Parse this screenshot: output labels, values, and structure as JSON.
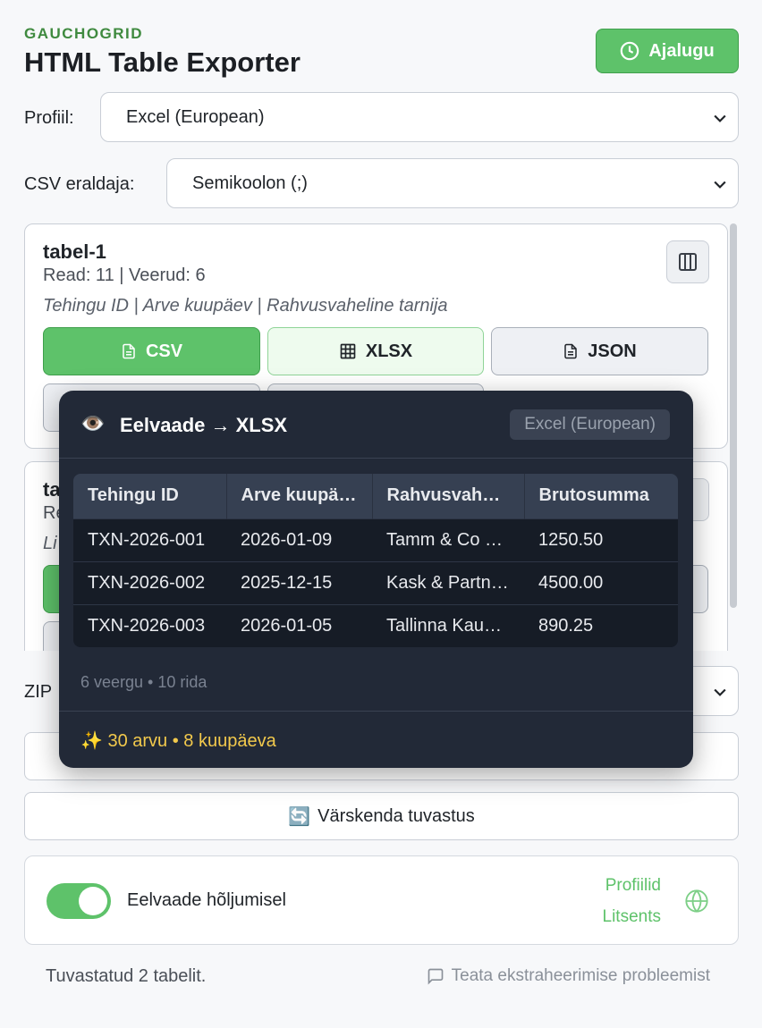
{
  "header": {
    "brand": "GAUCHOGRID",
    "title": "HTML Table Exporter",
    "history_label": "Ajalugu",
    "history_icon": "clock-icon"
  },
  "profile": {
    "label": "Profiil:",
    "value": "Excel (European)"
  },
  "csv_separator": {
    "label": "CSV eraldaja:",
    "value": "Semikoolon (;)"
  },
  "tables": [
    {
      "name": "tabel-1",
      "meta": "Read: 11 | Veerud: 6",
      "columns": "Tehingu ID | Arve kuupäev | Rahvusvaheline tarnija",
      "buttons": {
        "csv": "CSV",
        "xlsx": "XLSX",
        "json": "JSON"
      }
    },
    {
      "name_partial": "ta",
      "meta_partial": "Re",
      "columns_partial": "Li"
    }
  ],
  "zip": {
    "label_partial": "ZIP"
  },
  "actions": {
    "refresh_label": "Värskenda tuvastus",
    "refresh_icon": "🔄"
  },
  "settings": {
    "hover_preview_label": "Eelvaade hõljumisel",
    "hover_preview_on": true,
    "profiles_link": "Profiilid",
    "license_link": "Litsents"
  },
  "footer": {
    "status": "Tuvastatud 2 tabelit.",
    "report": "Teata ekstraheerimise probleemist"
  },
  "preview": {
    "eye": "👁️",
    "title": "Eelvaade → XLSX",
    "profile_badge": "Excel (European)",
    "headers": [
      "Tehingu ID",
      "Arve kuupäev",
      "Rahvusvaheline tarnija",
      "Brutosumma"
    ],
    "rows": [
      [
        "TXN-2026-001",
        "2026-01-09",
        "Tamm & Co OÜ",
        "1250.50"
      ],
      [
        "TXN-2026-002",
        "2025-12-15",
        "Kask & Partnerid",
        "4500.00"
      ],
      [
        "TXN-2026-003",
        "2026-01-05",
        "Tallinna Kaubandus",
        "890.25"
      ]
    ],
    "summary": "6 veergu • 10 rida",
    "detected": "✨ 30 arvu • 8 kuupäeva"
  },
  "colors": {
    "accent_green": "#5ec26a",
    "popup_bg": "#222937",
    "highlight_yellow": "#f2c94c"
  }
}
